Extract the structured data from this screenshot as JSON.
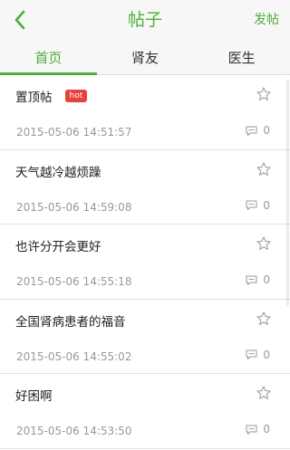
{
  "header": {
    "title": "帖子",
    "post_label": "发帖",
    "back_icon": "chevron-left-icon"
  },
  "colors": {
    "accent": "#4caf3a",
    "hot": "#e8403b"
  },
  "tabs": [
    {
      "label": "首页",
      "active": true
    },
    {
      "label": "肾友",
      "active": false
    },
    {
      "label": "医生",
      "active": false
    }
  ],
  "posts": [
    {
      "title": "置顶帖",
      "badge": "hot",
      "date": "2015-05-06 14:51:57",
      "comments": "0"
    },
    {
      "title": "天气越冷越烦躁",
      "date": "2015-05-06 14:59:08",
      "comments": "0"
    },
    {
      "title": "也许分开会更好",
      "date": "2015-05-06 14:55:18",
      "comments": "0"
    },
    {
      "title": "全国肾病患者的福音",
      "date": "2015-05-06 14:55:02",
      "comments": "0"
    },
    {
      "title": "好困啊",
      "date": "2015-05-06 14:53:50",
      "comments": "0"
    }
  ]
}
